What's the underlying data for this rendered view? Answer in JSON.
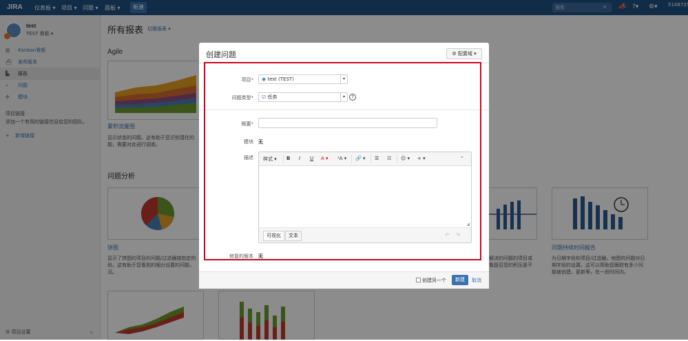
{
  "topbar": {
    "logo": "JIRA",
    "nav": [
      "仪表板 ▾",
      "项目 ▾",
      "问题 ▾",
      "面板 ▾"
    ],
    "create_label": "新建",
    "search_placeholder": "搜索",
    "user_fragment": "5148725"
  },
  "sidebar": {
    "project_name": "test",
    "board_name": "TEST 看板 ▾",
    "items": [
      {
        "label": "Kanban看板",
        "icon": "board-icon"
      },
      {
        "label": "发布版本",
        "icon": "release-icon"
      },
      {
        "label": "报告",
        "icon": "reports-icon"
      },
      {
        "label": "问题",
        "icon": "issues-icon"
      },
      {
        "label": "模块",
        "icon": "components-icon"
      }
    ],
    "links_heading": "项目链接",
    "links_text": "添加一个有用的链接信息给您的团队。",
    "add_link": "新增链接",
    "settings": "项目设置"
  },
  "main": {
    "title": "所有报表",
    "switch": "切换报表 ▾",
    "agile_heading": "Agile",
    "analysis_heading": "问题分析",
    "cumulative_title": "累积流量图",
    "cumulative_desc": [
      "显示状态的问题。这有助于您识别潜在的",
      "题，需要对此进行调查。"
    ],
    "pie_title": "饼图",
    "pie_desc": [
      "显示了饼图的项目的问题/过滤器按指定的",
      "段。这有助于您看到的细分设置的问题，",
      "况。"
    ],
    "res_desc": [
      "解决的问题的项目或",
      "看是否您的积压是不"
    ],
    "duration_title": "问题持续时间报告",
    "duration_desc": [
      "为日期字段和项目/过滤器，地图的问题对日",
      "期字段的设置。这可以帮助您跟踪有多少问",
      "题被创建、更新等，在一段时间内。"
    ]
  },
  "dialog": {
    "title": "创建问题",
    "config_label": "配置域 ▾",
    "project_label": "项目",
    "project_value": "test (TEST)",
    "type_label": "问题类型",
    "type_value": "任务",
    "summary_label": "概要",
    "component_label": "模块",
    "component_value": "无",
    "description_label": "描述",
    "toolbar": {
      "style": "样式 ▾",
      "bold": "B",
      "italic": "I",
      "underline": "U",
      "color": "A ▾",
      "more_text": "ᵃA ▾",
      "link": "🔗 ▾",
      "bullet": "☰",
      "numbered": "☷",
      "emoji": "☺ ▾",
      "insert": "+ ▾",
      "collapse": "⌃"
    },
    "tab_visual": "可视化",
    "tab_text": "文本",
    "fix_version_label": "修复的版本",
    "fix_version_value": "无",
    "create_another": "创建另一个",
    "create_button": "新建",
    "cancel": "取消"
  },
  "colors": {
    "topbar": "#205081",
    "primary": "#3b73af",
    "highlight_border": "#d0021b"
  }
}
